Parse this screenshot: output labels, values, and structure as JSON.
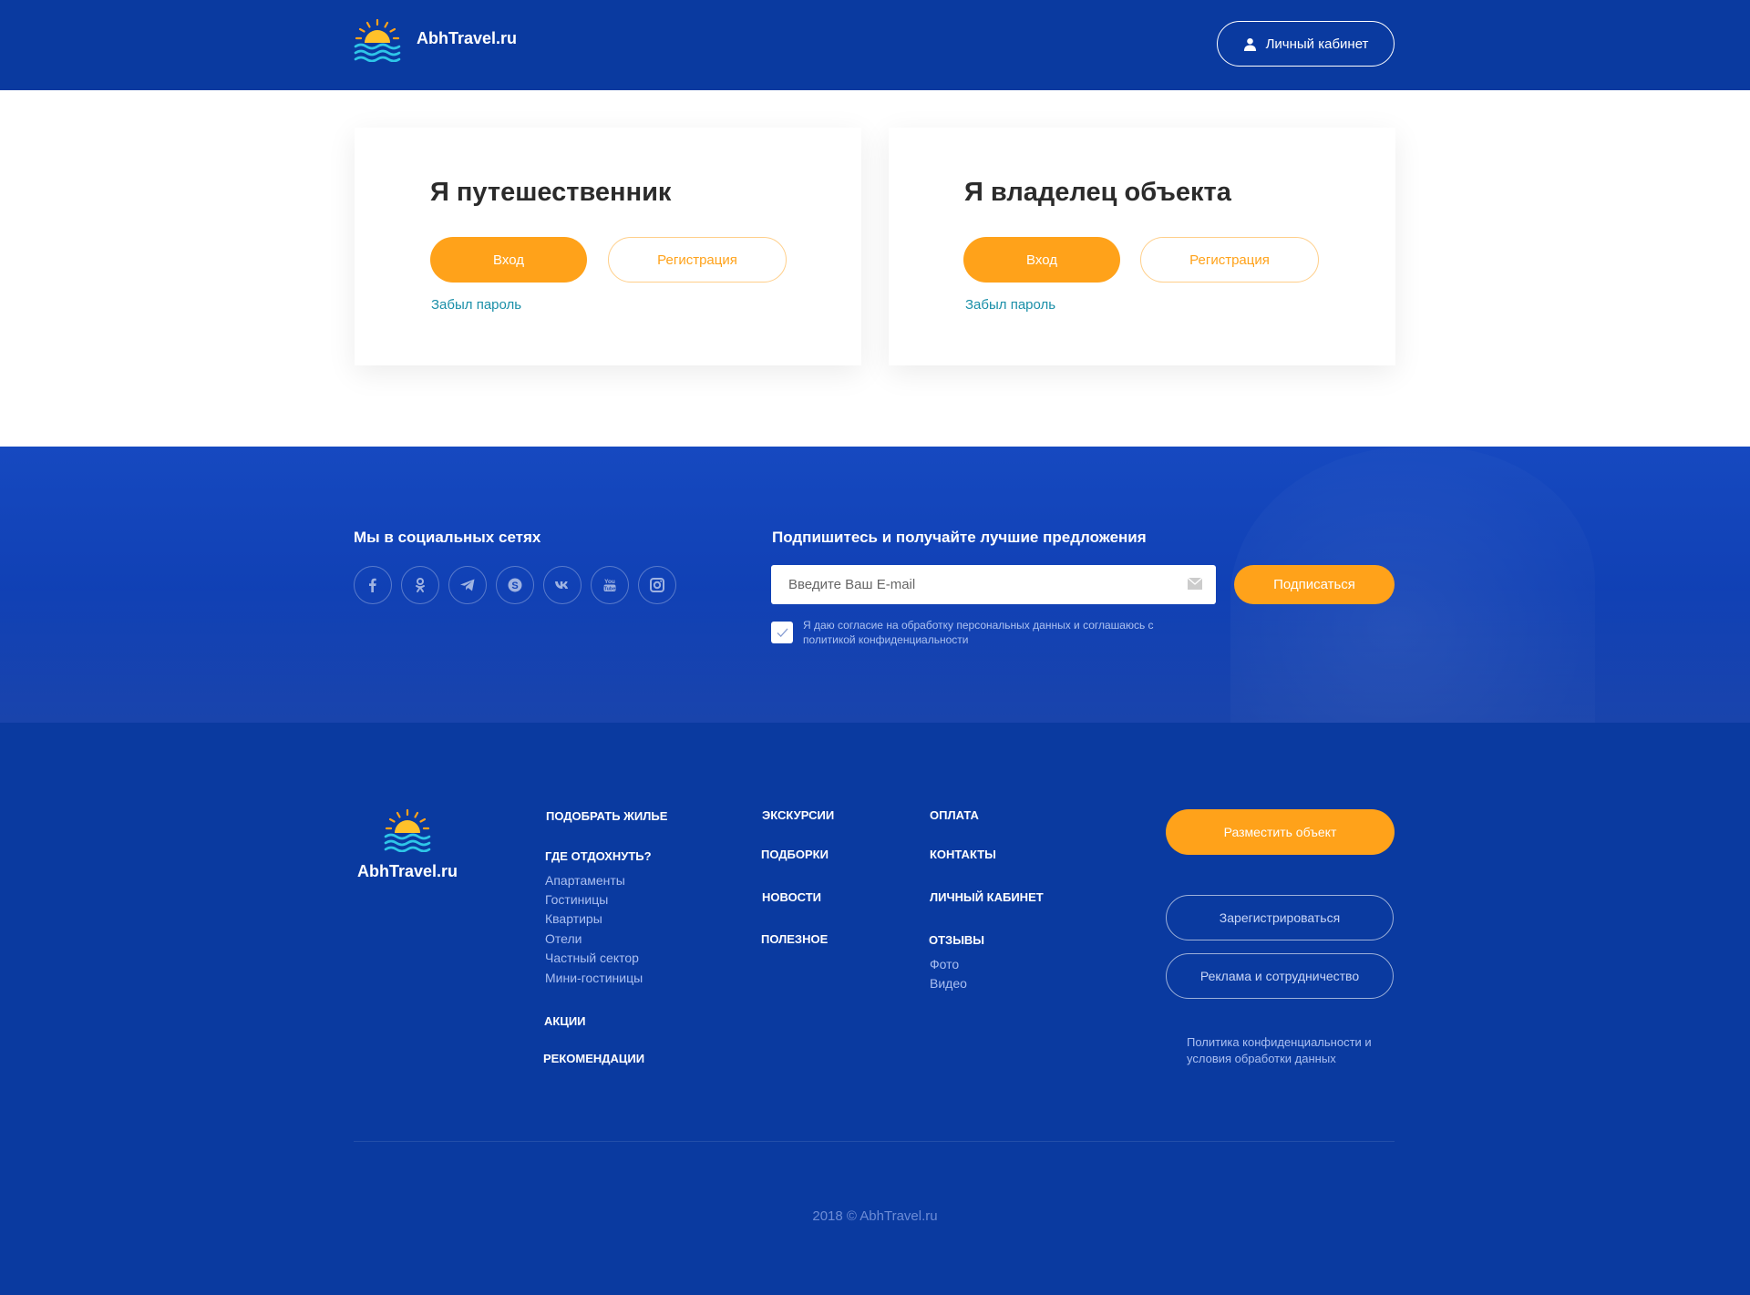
{
  "header": {
    "logo_text": "AbhTravel.ru",
    "cabinet_label": "Личный кабинет"
  },
  "cards": [
    {
      "title": "Я путешественник",
      "login_label": "Вход",
      "register_label": "Регистрация",
      "forgot_label": "Забыл пароль"
    },
    {
      "title": "Я владелец объекта",
      "login_label": "Вход",
      "register_label": "Регистрация",
      "forgot_label": "Забыл пароль"
    }
  ],
  "social": {
    "title": "Мы в социальных сетях",
    "icons": [
      "facebook-icon",
      "odnoklassniki-icon",
      "telegram-icon",
      "skype-icon",
      "vk-icon",
      "youtube-icon",
      "instagram-icon"
    ]
  },
  "subscribe": {
    "title": "Подпишитесь и получайте лучшие предложения",
    "email_placeholder": "Введите Ваш E-mail",
    "button_label": "Подписаться",
    "consent_text": "Я даю согласие на обработку персональных данных и соглашаюсь с политикой конфиденциальности",
    "consent_checked": true
  },
  "footer": {
    "logo_text": "AbhTravel.ru",
    "col1": {
      "choose_housing": "ПОДОБРАТЬ ЖИЛЬЕ",
      "where_rest": "ГДЕ ОТДОХНУТЬ?",
      "where_items": [
        "Апартаменты",
        "Гостиницы",
        "Квартиры",
        "Отели",
        "Частный сектор",
        "Мини-гостиницы"
      ],
      "promos": "АКЦИИ",
      "recommendations": "РЕКОМЕНДАЦИИ"
    },
    "col2": [
      "ЭКСКУРСИИ",
      "ПОДБОРКИ",
      "НОВОСТИ",
      "ПОЛЕЗНОЕ"
    ],
    "col3": {
      "payment": "ОПЛАТА",
      "contacts": "КОНТАКТЫ",
      "cabinet": "ЛИЧНЫЙ КАБИНЕТ",
      "reviews": "ОТЗЫВЫ",
      "review_items": [
        "Фото",
        "Видео"
      ]
    },
    "place_object_label": "Разместить объект",
    "register_label": "Зарегистрироваться",
    "ads_label": "Реклама и сотрудничество",
    "policy_text": "Политика конфиденциальности и условия обработки данных",
    "copyright": "2018 © AbhTravel.ru"
  },
  "colors": {
    "brand_blue": "#0a3aa0",
    "accent_orange": "#ffa21a",
    "link_teal": "#1a8fa8"
  }
}
